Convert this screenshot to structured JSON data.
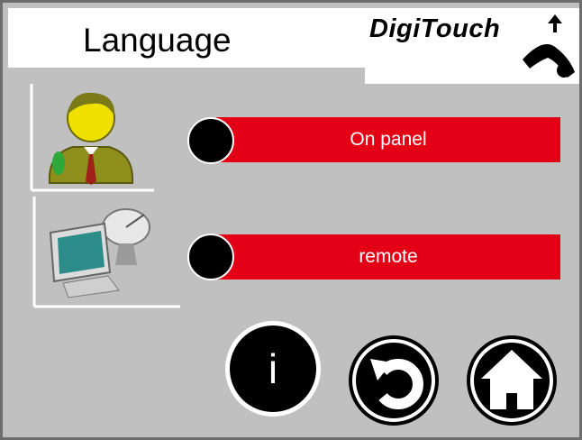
{
  "header": {
    "title": "Language"
  },
  "logo": {
    "text": "DigiTouch"
  },
  "options": [
    {
      "label": "On panel",
      "icon": "user-icon"
    },
    {
      "label": "remote",
      "icon": "remote-computer-icon"
    }
  ],
  "buttons": {
    "info_label": "i",
    "back_icon": "back-arrow-icon",
    "home_icon": "home-icon"
  },
  "colors": {
    "accent": "#e30016",
    "background": "#c0c0c0",
    "frame": "#6e6e6e"
  }
}
